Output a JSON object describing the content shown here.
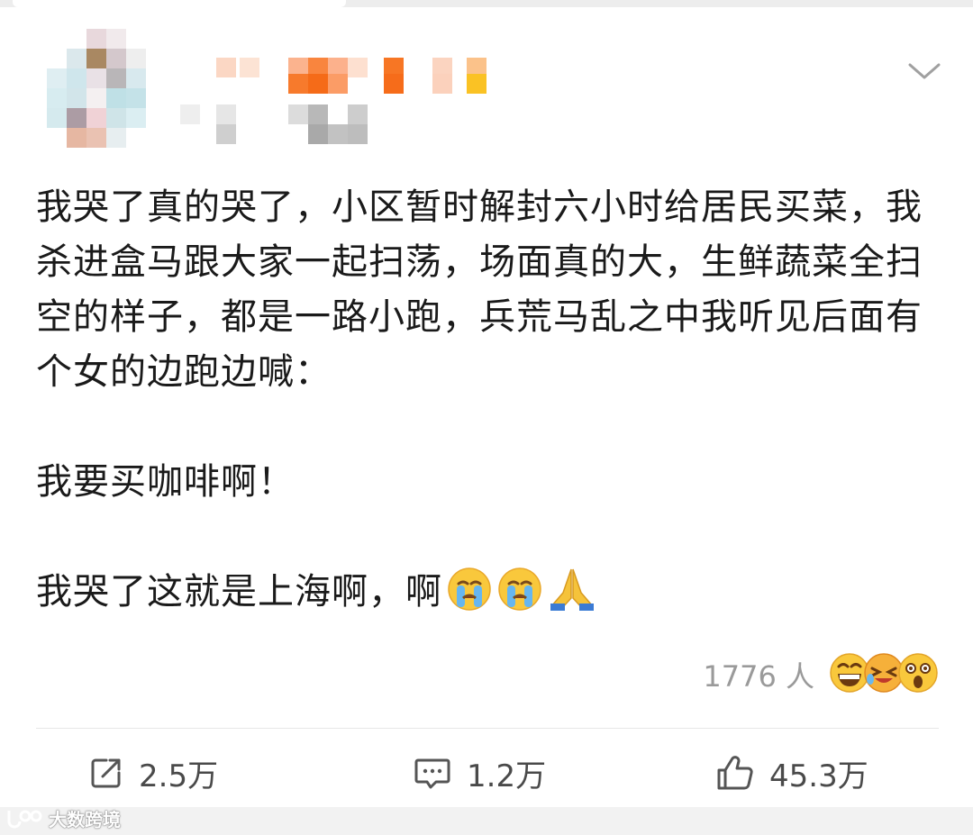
{
  "post": {
    "paragraph1": "我哭了真的哭了，小区暂时解封六小时给居民买菜，我杀进盒马跟大家一起扫荡，场面真的大，生鲜蔬菜全扫空的样子，都是一路小跑，兵荒马乱之中我听见后面有个女的边跑边喊：",
    "paragraph2": "我要买咖啡啊！",
    "paragraph3": "我哭了这就是上海啊，啊"
  },
  "reactions": {
    "count": "1776 人",
    "emojis": [
      "grin-icon",
      "laughing-tears-icon",
      "shocked-icon"
    ]
  },
  "actions": {
    "share": "2.5万",
    "comment": "1.2万",
    "like": "45.3万"
  },
  "watermark": "大数跨境",
  "icons": {
    "inline": [
      "crying-face-icon",
      "crying-face-icon",
      "praying-hands-icon"
    ],
    "menu": "chevron-down-icon"
  }
}
